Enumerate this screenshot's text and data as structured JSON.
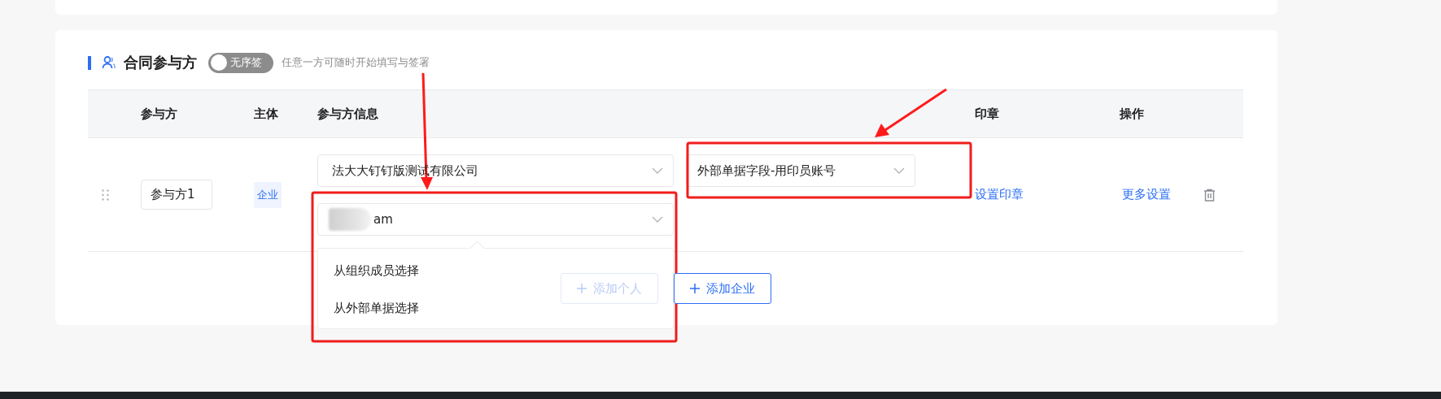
{
  "section": {
    "title": "合同参与方",
    "toggle": {
      "label": "无序签",
      "on": false
    },
    "hint": "任意一方可随时开始填写与签署"
  },
  "table": {
    "columns": [
      "参与方",
      "主体",
      "参与方信息",
      "印章",
      "操作"
    ],
    "rows": [
      {
        "name": "参与方1",
        "type_badge": "企业",
        "company": "法大大钉钉版测试有限公司",
        "person": "am",
        "person_blurred": true,
        "account_field": "外部单据字段-用印员账号",
        "seal_link": "设置印章",
        "more_link": "更多设置"
      }
    ]
  },
  "dropdown": {
    "open": true,
    "items": [
      {
        "label": "从组织成员选择"
      },
      {
        "label": "从外部单据选择"
      }
    ]
  },
  "buttons": [
    {
      "label": "添加个人",
      "disabled": true
    },
    {
      "label": "添加企业",
      "disabled": false
    }
  ]
}
